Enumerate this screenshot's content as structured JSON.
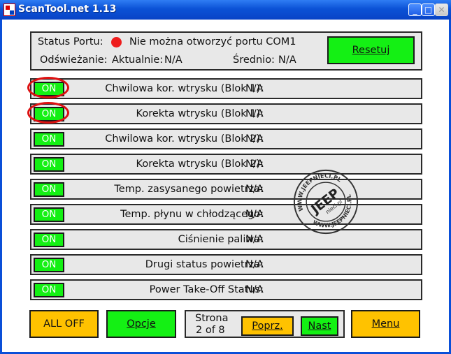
{
  "window": {
    "title": "ScanTool.net 1.13",
    "controls": {
      "minimize": "_",
      "maximize": "□",
      "close": "✕"
    }
  },
  "status": {
    "port_label": "Status Portu:",
    "port_message": "Nie można otworzyć portu COM1",
    "refresh_label": "Odświeżanie:",
    "current_label": "Aktualnie:",
    "current_value": "N/A",
    "average_label": "Średnio:",
    "average_value": "N/A",
    "reset_button": "Resetuj",
    "indicator_color": "#ee1c1c"
  },
  "sensors": [
    {
      "toggle": "ON",
      "label": "Chwilowa kor. wtrysku (Blok 1):",
      "value": "N/A",
      "highlighted": true
    },
    {
      "toggle": "ON",
      "label": "Korekta wtrysku (Blok 1):",
      "value": "N/A",
      "highlighted": true
    },
    {
      "toggle": "ON",
      "label": "Chwilowa kor. wtrysku (Blok 2):",
      "value": "N/A",
      "highlighted": false
    },
    {
      "toggle": "ON",
      "label": "Korekta wtrysku (Blok 2):",
      "value": "N/A",
      "highlighted": false
    },
    {
      "toggle": "ON",
      "label": "Temp. zasysanego powietrza:",
      "value": "N/A",
      "highlighted": false
    },
    {
      "toggle": "ON",
      "label": "Temp. płynu w chłodzącego:",
      "value": "N/A",
      "highlighted": false
    },
    {
      "toggle": "ON",
      "label": "Ciśnienie paliwa:",
      "value": "N/A",
      "highlighted": false
    },
    {
      "toggle": "ON",
      "label": "Drugi status powietrza:",
      "value": "N/A",
      "highlighted": false
    },
    {
      "toggle": "ON",
      "label": "Power Take-Off Status:",
      "value": "N/A",
      "highlighted": false
    }
  ],
  "footer": {
    "all_off": "ALL OFF",
    "options": "Opcje",
    "page_label": "Strona",
    "page_info": "2 of 8",
    "prev": "Poprz.",
    "next": "Nast",
    "menu": "Menu"
  },
  "watermark": {
    "ring_top": "WWW.JEEPNIECI.PL",
    "ring_bottom": "WWW.JEEPNIECI.PL",
    "center_big": "JEEP",
    "center_small": "nieci.pl"
  },
  "colors": {
    "title_bar": "#0b52d6",
    "button_green": "#14f014",
    "button_yellow": "#ffc200",
    "highlight_circle": "#dd1111",
    "panel_bg": "#e8e8e8"
  }
}
